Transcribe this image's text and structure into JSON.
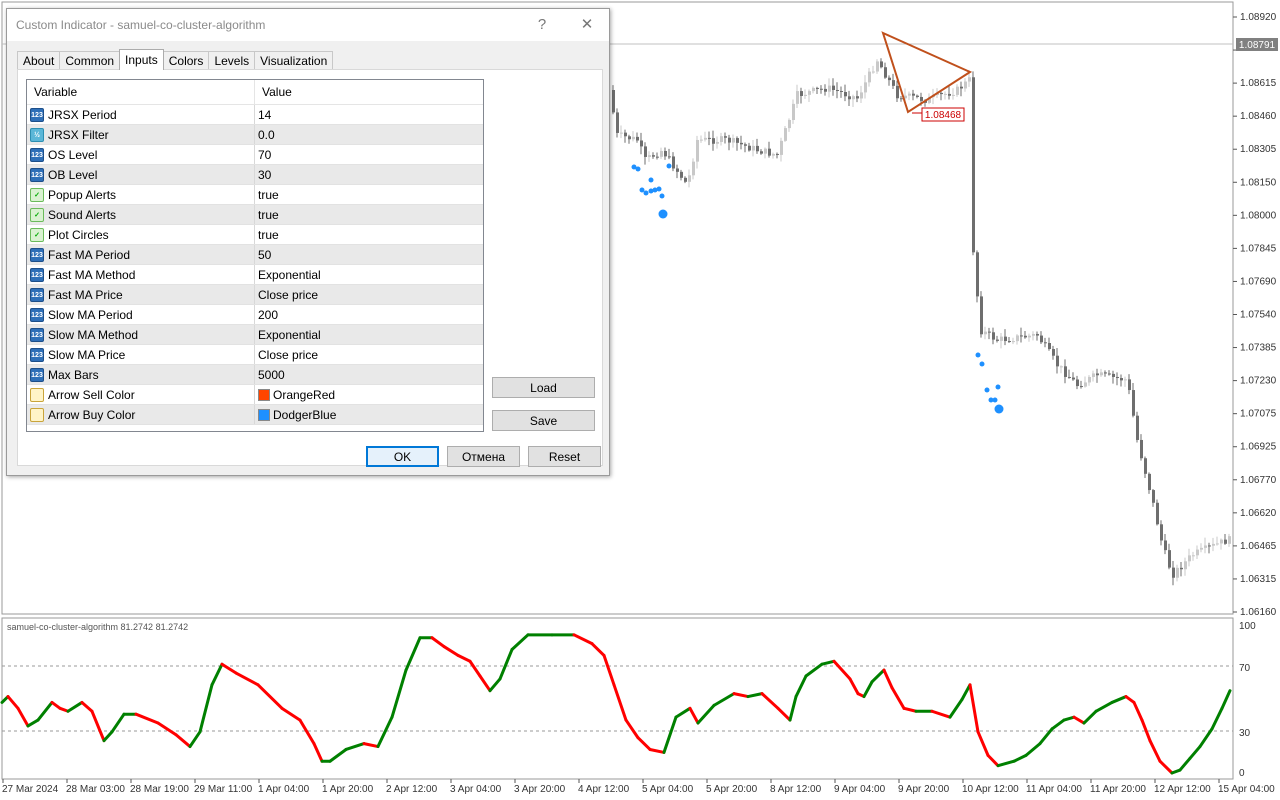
{
  "chart": {
    "price_labels": [
      "1.08920",
      "1.08791",
      "1.08615",
      "1.08460",
      "1.08305",
      "1.08150",
      "1.08000",
      "1.07845",
      "1.07690",
      "1.07540",
      "1.07385",
      "1.07230",
      "1.07075",
      "1.06925",
      "1.06770",
      "1.06620",
      "1.06465",
      "1.06315",
      "1.06160"
    ],
    "current_price": "1.08791",
    "line_price_label": "1.08468",
    "indicator_header": "samuel-co-cluster-algorithm 81.2742 81.2742",
    "indicator_levels": [
      "100",
      "70",
      "30",
      "0"
    ],
    "time_labels": [
      "27 Mar 2024",
      "28 Mar 03:00",
      "28 Mar 19:00",
      "29 Mar 11:00",
      "1 Apr 04:00",
      "1 Apr 20:00",
      "2 Apr 12:00",
      "3 Apr 04:00",
      "3 Apr 20:00",
      "4 Apr 12:00",
      "5 Apr 04:00",
      "5 Apr 20:00",
      "8 Apr 12:00",
      "9 Apr 04:00",
      "9 Apr 20:00",
      "10 Apr 12:00",
      "11 Apr 04:00",
      "11 Apr 20:00",
      "12 Apr 12:00",
      "15 Apr 04:00"
    ],
    "colors": {
      "up": "#008000",
      "down": "#ff0000",
      "sell_arrow": "#ff4500",
      "buy_arrow": "#1e90ff",
      "triangle": "#c0501c",
      "candle_bull": "#c8c8c8",
      "candle_bear": "#6e6e6e"
    }
  },
  "dialog": {
    "title": "Custom Indicator - samuel-co-cluster-algorithm",
    "help_glyph": "?",
    "close_glyph": "✕",
    "tabs": [
      "About",
      "Common",
      "Inputs",
      "Colors",
      "Levels",
      "Visualization"
    ],
    "active_tab": "Inputs",
    "columns": [
      "Variable",
      "Value"
    ],
    "rows": [
      {
        "icon": "int",
        "variable": "JRSX Period",
        "value": "14"
      },
      {
        "icon": "dbl",
        "variable": "JRSX Filter",
        "value": "0.0"
      },
      {
        "icon": "int",
        "variable": "OS Level",
        "value": "70"
      },
      {
        "icon": "int",
        "variable": "OB Level",
        "value": "30"
      },
      {
        "icon": "bool",
        "variable": "Popup Alerts",
        "value": "true"
      },
      {
        "icon": "bool",
        "variable": "Sound Alerts",
        "value": "true"
      },
      {
        "icon": "bool",
        "variable": "Plot Circles",
        "value": "true"
      },
      {
        "icon": "int",
        "variable": "Fast MA Period",
        "value": "50"
      },
      {
        "icon": "int",
        "variable": "Fast MA Method",
        "value": "Exponential"
      },
      {
        "icon": "int",
        "variable": "Fast MA Price",
        "value": "Close price"
      },
      {
        "icon": "int",
        "variable": "Slow MA Period",
        "value": "200"
      },
      {
        "icon": "int",
        "variable": "Slow MA Method",
        "value": "Exponential"
      },
      {
        "icon": "int",
        "variable": "Slow MA Price",
        "value": "Close price"
      },
      {
        "icon": "int",
        "variable": "Max Bars",
        "value": "5000"
      },
      {
        "icon": "clr",
        "variable": "Arrow Sell Color",
        "value": "OrangeRed",
        "swatch": "#ff4500"
      },
      {
        "icon": "clr",
        "variable": "Arrow Buy Color",
        "value": "DodgerBlue",
        "swatch": "#1e90ff"
      }
    ],
    "buttons": {
      "load": "Load",
      "save": "Save",
      "ok": "OK",
      "cancel": "Отмена",
      "reset": "Reset"
    }
  }
}
